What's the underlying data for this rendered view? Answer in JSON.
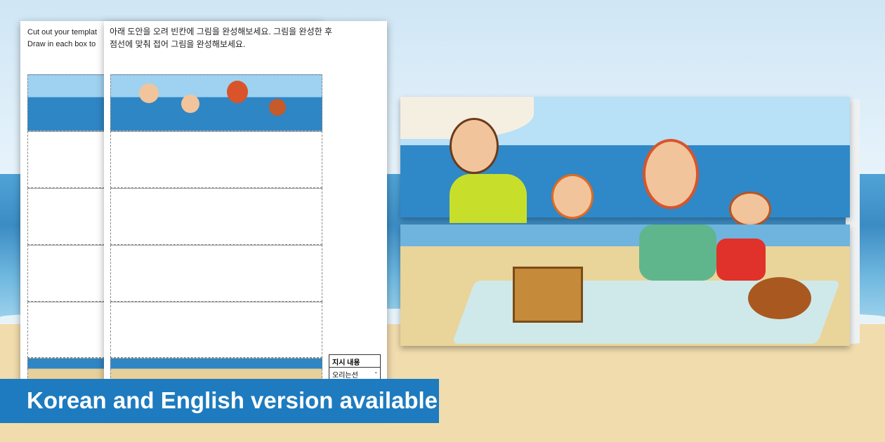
{
  "banner": {
    "text": "Korean and English version available",
    "color": "#1e7bbf"
  },
  "english_sheet": {
    "instructions": "Cut out your templat\nDraw in each box to"
  },
  "korean_sheet": {
    "instructions": "아래 도안을 오려 빈칸에 그림을 완성해보세요. 그림을 완성한 후\n점선에 맞춰 접어 그림을 완성해보세요.",
    "instruction_box": {
      "title": "지시 내용",
      "row_label": "오리는선",
      "row_value": "-"
    }
  },
  "colors": {
    "sea": "#3c8cc4",
    "sand": "#f1dcae",
    "sky": "#cfe6f5"
  }
}
